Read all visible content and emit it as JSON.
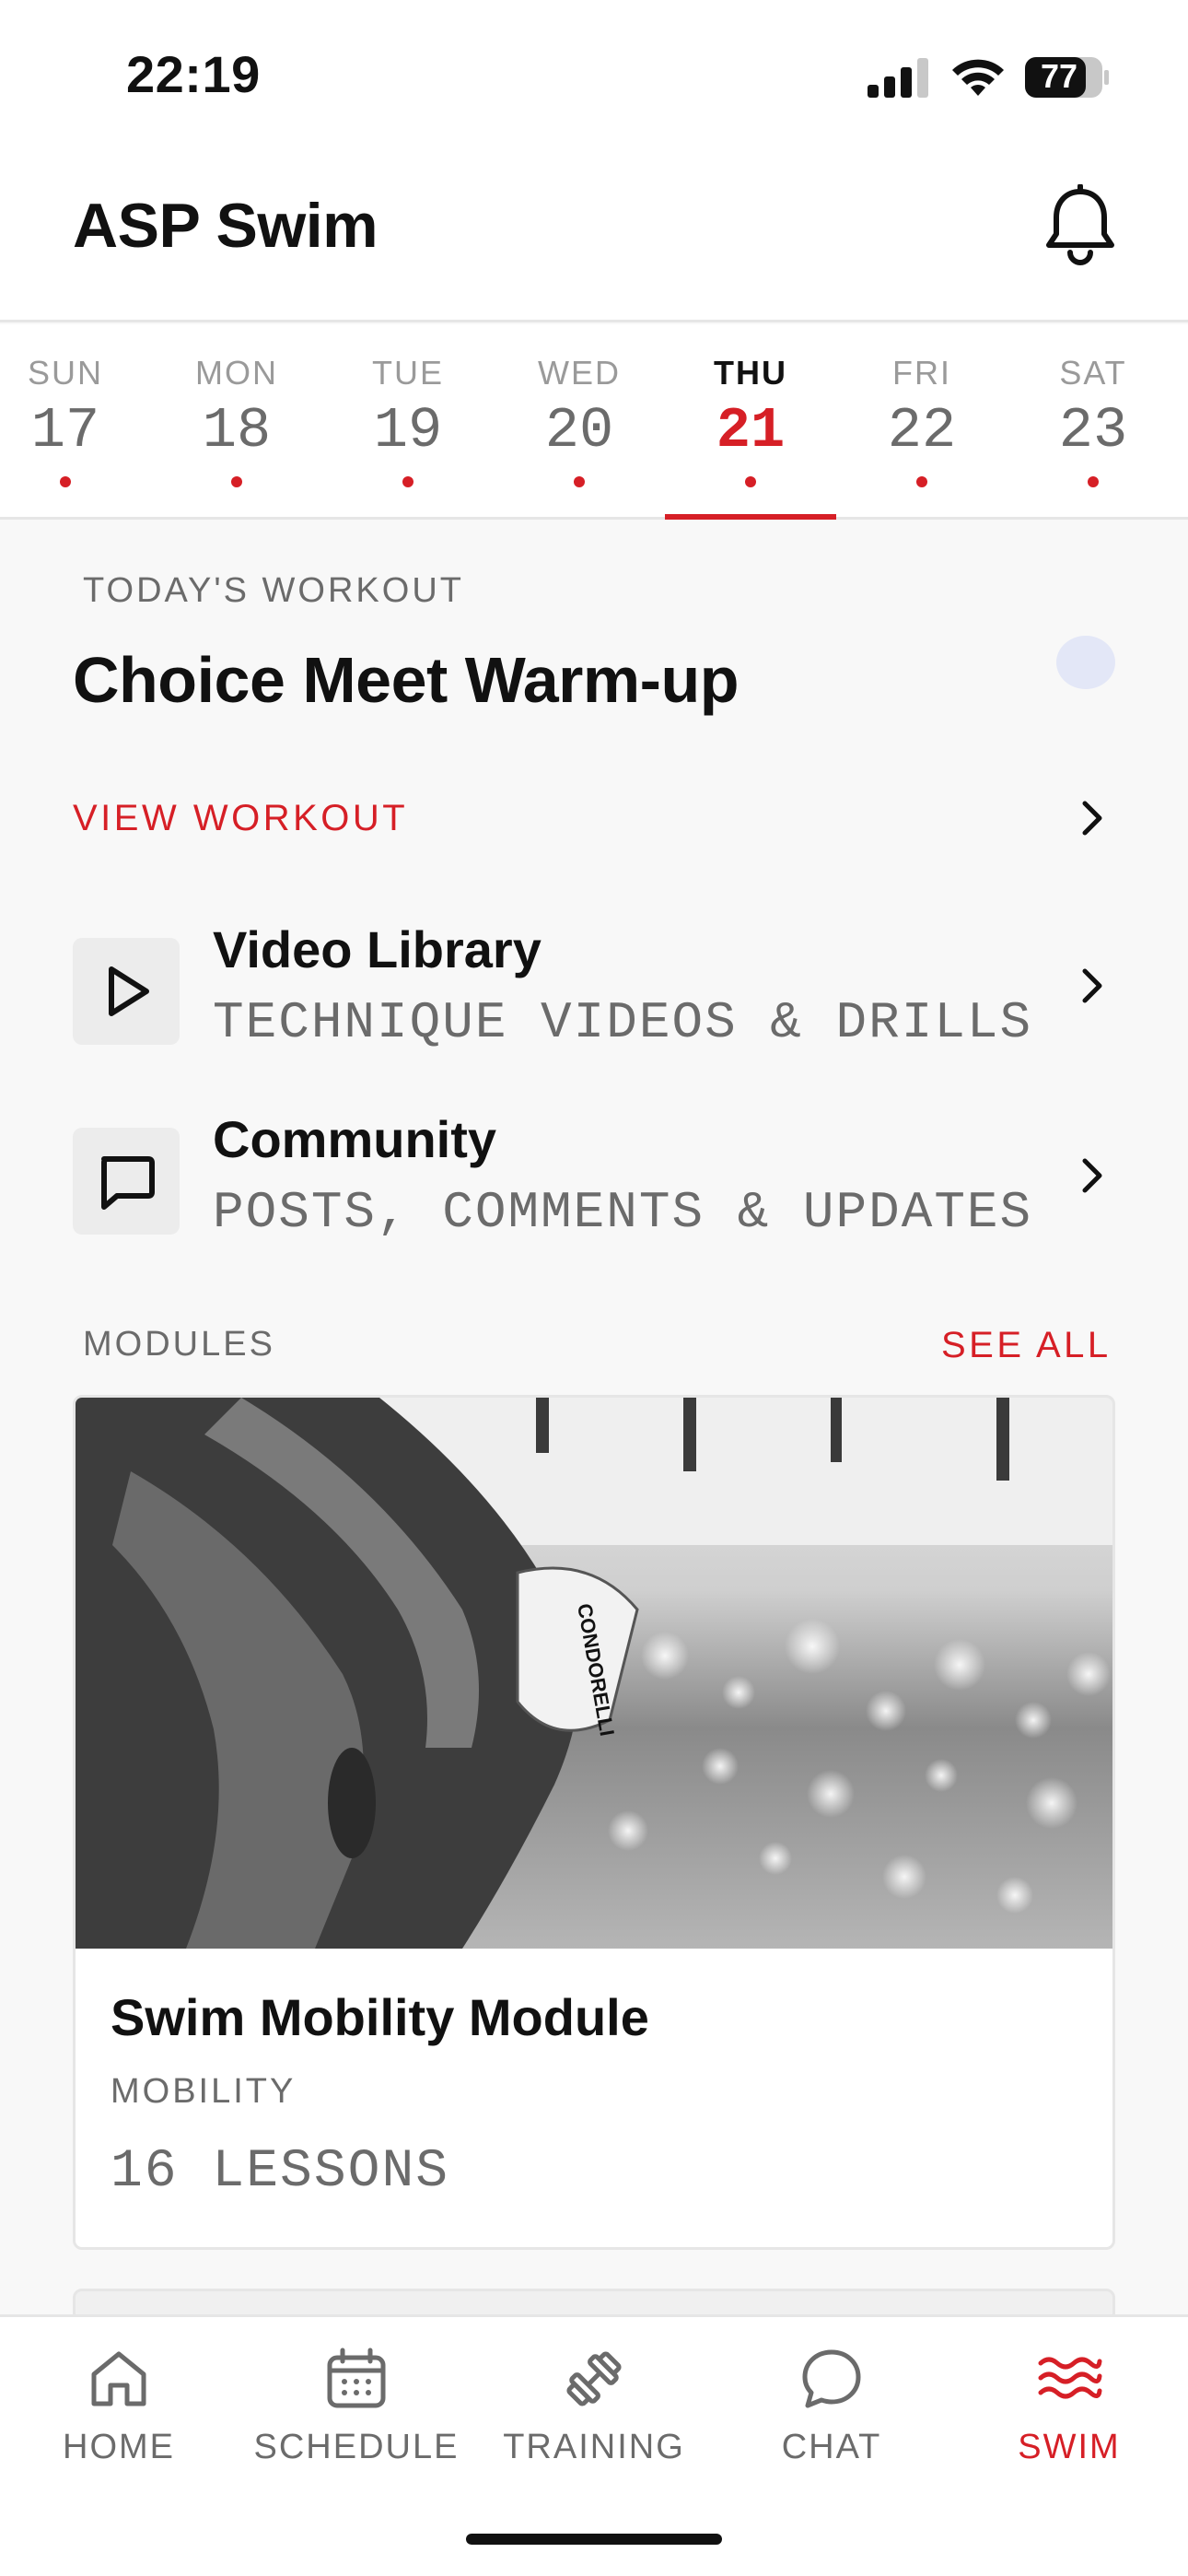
{
  "status_bar": {
    "time": "22:19",
    "battery": "77"
  },
  "header": {
    "title": "ASP Swim"
  },
  "week": {
    "days": [
      {
        "dow": "SUN",
        "num": "17"
      },
      {
        "dow": "MON",
        "num": "18"
      },
      {
        "dow": "TUE",
        "num": "19"
      },
      {
        "dow": "WED",
        "num": "20"
      },
      {
        "dow": "THU",
        "num": "21",
        "active": true
      },
      {
        "dow": "FRI",
        "num": "22"
      },
      {
        "dow": "SAT",
        "num": "23"
      }
    ]
  },
  "today": {
    "label": "TODAY'S WORKOUT",
    "title": "Choice Meet Warm-up",
    "view_label": "VIEW WORKOUT"
  },
  "links": [
    {
      "title": "Video Library",
      "subtitle": "TECHNIQUE VIDEOS & DRILLS",
      "icon": "play-icon"
    },
    {
      "title": "Community",
      "subtitle": "POSTS, COMMENTS & UPDATES",
      "icon": "chat-bubble-icon"
    }
  ],
  "modules": {
    "label": "MODULES",
    "see_all": "SEE ALL",
    "cards": [
      {
        "title": "Swim Mobility Module",
        "category": "MOBILITY",
        "lessons": "16 LESSONS",
        "cap_text": "CONDORELLI"
      }
    ]
  },
  "tabbar": {
    "tabs": [
      {
        "label": "HOME",
        "icon": "home-icon"
      },
      {
        "label": "SCHEDULE",
        "icon": "calendar-icon"
      },
      {
        "label": "TRAINING",
        "icon": "dumbbell-icon"
      },
      {
        "label": "CHAT",
        "icon": "chat-icon"
      },
      {
        "label": "SWIM",
        "icon": "waves-icon",
        "active": true
      }
    ]
  },
  "colors": {
    "accent": "#d61f26",
    "muted": "#6b6b6b",
    "background": "#f8f8f8"
  }
}
